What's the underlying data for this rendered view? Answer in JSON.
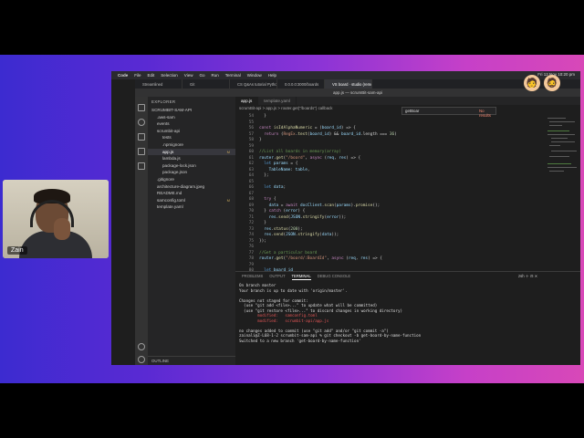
{
  "webcam": {
    "name": "Zain"
  },
  "menubar": {
    "items": [
      "Code",
      "File",
      "Edit",
      "Selection",
      "View",
      "Go",
      "Run",
      "Terminal",
      "Window",
      "Help"
    ],
    "clock": "Fri 12 Nov 10:20 pm"
  },
  "browser_tabs": [
    "Streamlined",
    "Git",
    "CS Q&As tutorial Python",
    "0.0.0.0:3000/boards",
    "VS board · studio (remote) · demo"
  ],
  "vscode": {
    "title": "app.js — scrumBit-sam-api",
    "explorer_title": "EXPLORER",
    "tree": [
      {
        "label": "SCRUMBIT-SAM-API",
        "indent": 0,
        "badge": ""
      },
      {
        "label": ".aws-sam",
        "indent": 1,
        "badge": ""
      },
      {
        "label": "events",
        "indent": 1,
        "badge": ""
      },
      {
        "label": "scrumbit-api",
        "indent": 1,
        "badge": ""
      },
      {
        "label": "tests",
        "indent": 2,
        "badge": ""
      },
      {
        "label": ".npmignore",
        "indent": 2,
        "badge": ""
      },
      {
        "label": "app.js",
        "indent": 2,
        "badge": "M",
        "selected": true
      },
      {
        "label": "lambda.js",
        "indent": 2,
        "badge": ""
      },
      {
        "label": "package-lock.json",
        "indent": 2,
        "badge": ""
      },
      {
        "label": "package.json",
        "indent": 2,
        "badge": ""
      },
      {
        "label": ".gitignore",
        "indent": 1,
        "badge": ""
      },
      {
        "label": "architecture-diagram.jpeg",
        "indent": 1,
        "badge": ""
      },
      {
        "label": "README.md",
        "indent": 1,
        "badge": ""
      },
      {
        "label": "samconfig.toml",
        "indent": 1,
        "badge": "M"
      },
      {
        "label": "template.yaml",
        "indent": 1,
        "badge": ""
      }
    ],
    "outline": "OUTLINE",
    "editor_tabs": [
      "app.js",
      "template.yaml"
    ],
    "breadcrumb": "scrumBit-api  >  app.js  >  router.get(\"/boards\") callback",
    "find": {
      "query": "getBoar",
      "result": "No results"
    },
    "panel_tabs": [
      "PROBLEMS",
      "OUTPUT",
      "TERMINAL",
      "DEBUG CONSOLE"
    ],
    "panel_active": "TERMINAL",
    "terminal_name": "zsh",
    "terminal_lines": [
      {
        "text": "On branch master",
        "red": false
      },
      {
        "text": "Your branch is up to date with 'origin/master'.",
        "red": false
      },
      {
        "text": "",
        "red": false
      },
      {
        "text": "Changes not staged for commit:",
        "red": false
      },
      {
        "text": "  (use \"git add <file>...\" to update what will be committed)",
        "red": false
      },
      {
        "text": "  (use \"git restore <file>...\" to discard changes in working directory)",
        "red": false
      },
      {
        "text": "        modified:   samconfig.toml",
        "red": true
      },
      {
        "text": "        modified:   scrumbit-api/app.js",
        "red": true
      },
      {
        "text": "",
        "red": false
      },
      {
        "text": "no changes added to commit (use \"git add\" and/or \"git commit -a\")",
        "red": false
      },
      {
        "text": "zainali@Z-L68-1-2 scrumbit-sam-api % git checkout -b get-board-by-name-function",
        "red": false
      },
      {
        "text": "Switched to a new branch 'get-board-by-name-function'",
        "red": false
      }
    ]
  },
  "code_lines": [
    {
      "n": "54",
      "html": "  }"
    },
    {
      "n": "55",
      "html": ""
    },
    {
      "n": "56",
      "html": "<span class='kw'>const</span> <span class='fn'>isIdAlphaNumeric</span> = (<span class='var'>board_id</span>) => {"
    },
    {
      "n": "57",
      "html": "  <span class='kw'>return</span> (<span class='str'>RegEx</span>.<span class='fn'>test</span>(<span class='var'>board_id</span>) && <span class='var'>board_id</span>.length === <span class='num'>36</span>)"
    },
    {
      "n": "58",
      "html": "}"
    },
    {
      "n": "59",
      "html": ""
    },
    {
      "n": "60",
      "html": "<span class='cm'>//List all boards in memory(array)</span>"
    },
    {
      "n": "61",
      "html": "<span class='var'>router</span>.<span class='fn'>get</span>(<span class='str'>\"/board\"</span>, <span class='kw'>async</span> (<span class='var'>req</span>, <span class='var'>res</span>) => {"
    },
    {
      "n": "62",
      "html": "  <span class='bl'>let</span> <span class='var'>params</span> = {"
    },
    {
      "n": "63",
      "html": "    <span class='var'>TableName</span>: <span class='var'>table</span>,"
    },
    {
      "n": "64",
      "html": "  };"
    },
    {
      "n": "65",
      "html": ""
    },
    {
      "n": "66",
      "html": "  <span class='bl'>let</span> <span class='var'>data</span>;"
    },
    {
      "n": "67",
      "html": ""
    },
    {
      "n": "68",
      "html": "  <span class='kw'>try</span> {"
    },
    {
      "n": "69",
      "html": "    <span class='var'>data</span> = <span class='kw'>await</span> <span class='var'>docClient</span>.<span class='fn'>scan</span>(<span class='var'>params</span>).<span class='fn'>promise</span>();"
    },
    {
      "n": "70",
      "html": "  } <span class='kw'>catch</span> (<span class='var'>error</span>) {"
    },
    {
      "n": "71",
      "html": "    <span class='var'>res</span>.<span class='fn'>send</span>(<span class='var'>JSON</span>.<span class='fn'>stringify</span>(<span class='var'>error</span>));"
    },
    {
      "n": "72",
      "html": "  }"
    },
    {
      "n": "73",
      "html": "  <span class='var'>res</span>.<span class='fn'>status</span>(<span class='num'>200</span>);"
    },
    {
      "n": "74",
      "html": "  <span class='var'>res</span>.<span class='fn'>send</span>(<span class='var'>JSON</span>.<span class='fn'>stringify</span>(<span class='var'>data</span>));"
    },
    {
      "n": "75",
      "html": "});"
    },
    {
      "n": "76",
      "html": ""
    },
    {
      "n": "77",
      "html": "<span class='cm'>//Get a particular board</span>"
    },
    {
      "n": "78",
      "html": "<span class='var'>router</span>.<span class='fn'>get</span>(<span class='str'>\"/board/:BoardId\"</span>, <span class='kw'>async</span> (<span class='var'>req</span>, <span class='var'>res</span>) => {"
    },
    {
      "n": "79",
      "html": ""
    },
    {
      "n": "80",
      "html": "  <span class='bl'>let</span> <span class='var'>board_id</span>"
    },
    {
      "n": "81",
      "html": "  <span class='kw'>if</span> (!(<span class='str'>'BoardId'</span> <span class='kw'>in</span> <span class='var'>req</span>.<span class='var'>params</span>)) {"
    },
    {
      "n": "82",
      "html": "    <span class='var'>board_id</span> = <span class='str'>\"\"</span>"
    }
  ]
}
